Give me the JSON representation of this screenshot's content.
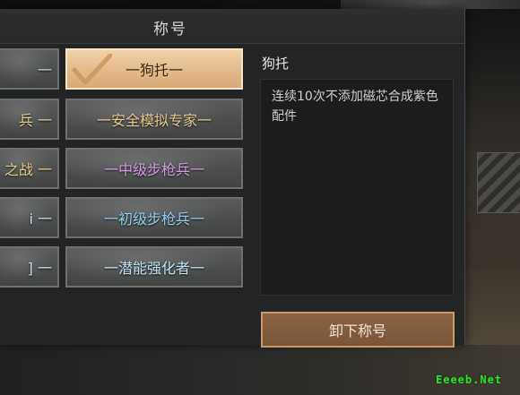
{
  "header": {
    "title": "称号"
  },
  "colors": {
    "selected_text": "#3a2a18",
    "gold": "#e8c98e",
    "purple": "#d59ae6",
    "cyan": "#8fd2f0",
    "light_cyan": "#bfe3f3",
    "button_bg": "#7e5838"
  },
  "left_column": [
    {
      "label": "一",
      "color": "#b8d8ea"
    },
    {
      "label": "兵 一",
      "color": "#e8c98e"
    },
    {
      "label": "之战 一",
      "color": "#e8c98e"
    },
    {
      "label": "i 一",
      "color": "#bfe3f3"
    },
    {
      "label": "] 一",
      "color": "#bfe3f3"
    }
  ],
  "titles": [
    {
      "label": "一狗托一",
      "selected": true,
      "color": "#3a2a18"
    },
    {
      "label": "一安全模拟专家一",
      "selected": false,
      "color": "#e8c98e"
    },
    {
      "label": "一中级步枪兵一",
      "selected": false,
      "color": "#d59ae6"
    },
    {
      "label": "一初级步枪兵一",
      "selected": false,
      "color": "#8fd2f0"
    },
    {
      "label": "一潜能强化者一",
      "selected": false,
      "color": "#bfe3f3"
    }
  ],
  "detail": {
    "name": "狗托",
    "description": "连续10次不添加磁芯合成紫色配件",
    "unequip_label": "卸下称号"
  },
  "watermark": "Eeeeb.Net"
}
